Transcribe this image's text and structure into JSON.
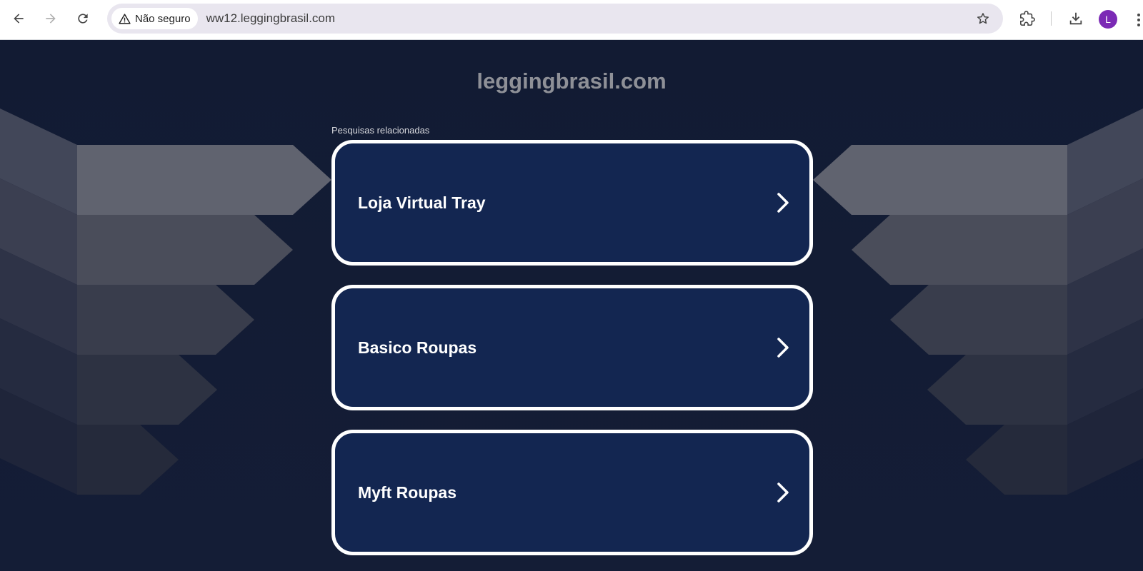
{
  "browser": {
    "security_label": "Não seguro",
    "url": "ww12.leggingbrasil.com",
    "profile_initial": "L",
    "icons": {
      "back": "back-arrow-icon",
      "forward": "forward-arrow-icon",
      "reload": "reload-icon",
      "warning": "warning-triangle-icon",
      "bookmark": "star-icon",
      "extensions": "puzzle-icon",
      "downloads": "download-icon"
    }
  },
  "page": {
    "site_title": "leggingbrasil.com",
    "related_label": "Pesquisas relacionadas",
    "results": [
      {
        "label": "Loja Virtual Tray"
      },
      {
        "label": "Basico Roupas"
      },
      {
        "label": "Myft Roupas"
      }
    ]
  },
  "colors": {
    "page_background": "#131c35",
    "card_background": "#132651",
    "card_border": "#ffffff",
    "title_color": "#8e9097",
    "avatar_color": "#7b2ab5"
  }
}
